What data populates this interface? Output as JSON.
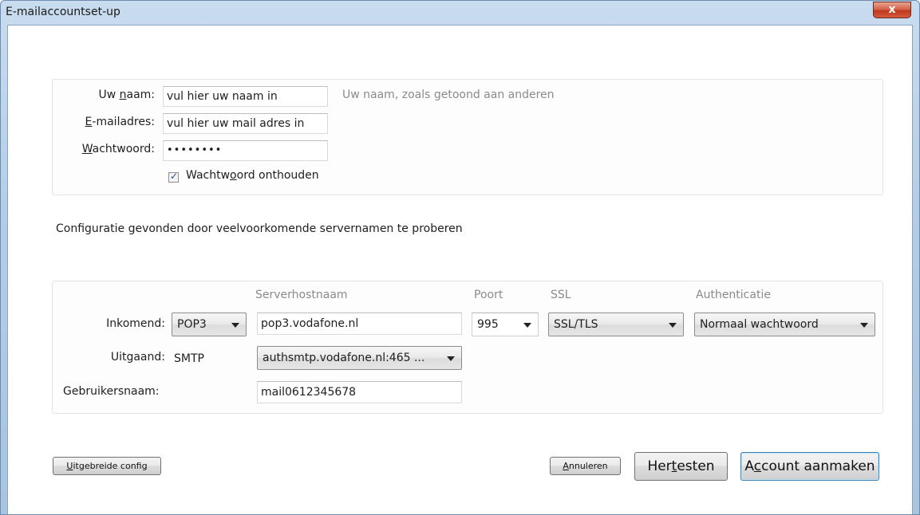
{
  "window": {
    "title": "E-mailaccountset-up",
    "close_label": "x"
  },
  "identity": {
    "name_label": "Uw naam:",
    "name_value": "vul hier uw naam in",
    "name_hint": "Uw naam, zoals getoond aan anderen",
    "email_label": "E-mailadres:",
    "email_value": "vul hier uw mail adres in",
    "password_label": "Wachtwoord:",
    "password_value": "••••••••",
    "remember_label": "Wachtwoord onthouden",
    "remember_checked": true
  },
  "status_text": "Configuratie gevonden door veelvoorkomende servernamen te proberen",
  "server": {
    "headers": {
      "hostname": "Serverhostnaam",
      "port": "Poort",
      "ssl": "SSL",
      "auth": "Authenticatie"
    },
    "incoming": {
      "label": "Inkomend:",
      "protocol": "POP3",
      "hostname": "pop3.vodafone.nl",
      "port": "995",
      "ssl": "SSL/TLS",
      "auth": "Normaal wachtwoord"
    },
    "outgoing": {
      "label": "Uitgaand:",
      "protocol": "SMTP",
      "server": "authsmtp.vodafone.nl:465 ..."
    },
    "username": {
      "label": "Gebruikersnaam:",
      "value": "mail0612345678"
    }
  },
  "buttons": {
    "advanced": "Uitgebreide config",
    "cancel": "Annuleren",
    "retest": "Hertesten",
    "create": "Account aanmaken"
  }
}
